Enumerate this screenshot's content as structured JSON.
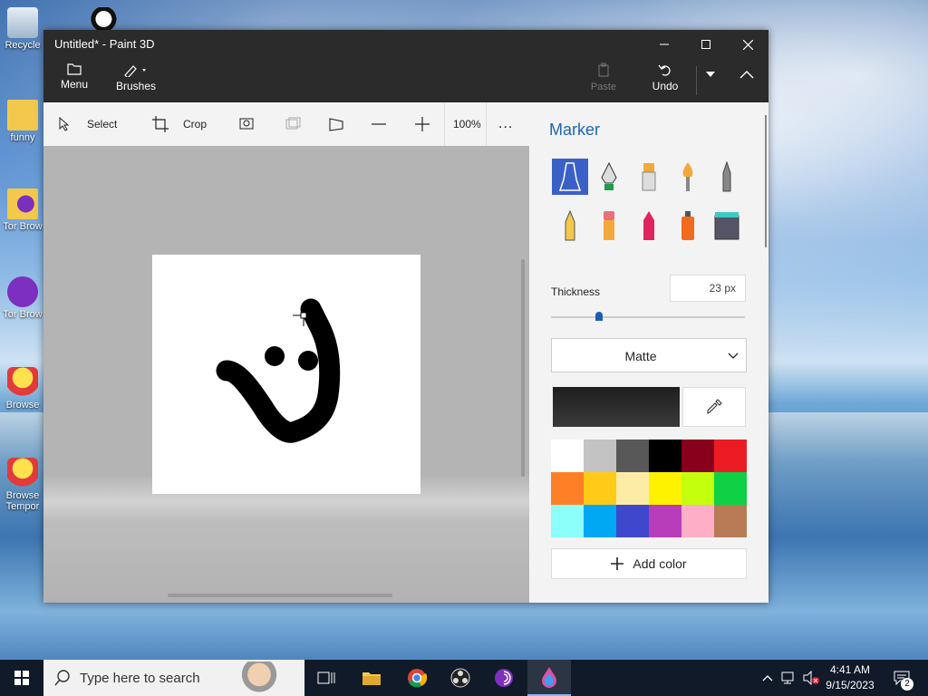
{
  "desktop": {
    "icons": [
      {
        "label": "Recycle"
      },
      {
        "label": "funny"
      },
      {
        "label": "Tor Brow"
      },
      {
        "label": "Tor Brow"
      },
      {
        "label": "Browse"
      },
      {
        "label": "Browse Tempor"
      }
    ]
  },
  "window": {
    "title": "Untitled* - Paint 3D"
  },
  "ribbon": {
    "menu_label": "Menu",
    "brushes_label": "Brushes",
    "paste_label": "Paste",
    "undo_label": "Undo"
  },
  "toolbar": {
    "select_label": "Select",
    "crop_label": "Crop",
    "zoom_value": "100%",
    "more_label": "..."
  },
  "panel": {
    "title": "Marker",
    "thickness_label": "Thickness",
    "thickness_value": "23",
    "thickness_unit": "px",
    "thickness_fraction": 0.23,
    "finish_value": "Matte",
    "current_color": "#1f1f1f",
    "add_color_label": "Add color",
    "swatches": [
      "#ffffff",
      "#c3c3c3",
      "#585858",
      "#000000",
      "#88001b",
      "#ec1c24",
      "#ff7f27",
      "#ffca18",
      "#fdeca6",
      "#fff200",
      "#c4ff0e",
      "#0ed145",
      "#8cfffb",
      "#00a8f3",
      "#3f48cc",
      "#b83dba",
      "#ffaec8",
      "#b97a56"
    ]
  },
  "taskbar": {
    "search_placeholder": "Type here to search",
    "time": "4:41 AM",
    "date": "9/15/2023",
    "notifications": "2"
  }
}
